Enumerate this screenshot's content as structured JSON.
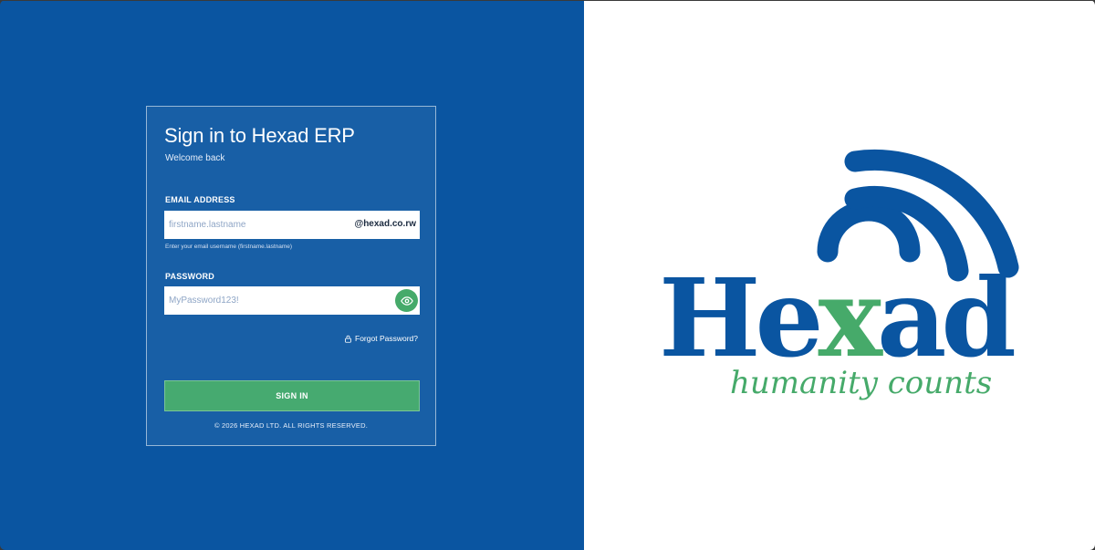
{
  "login": {
    "title": "Sign in to Hexad ERP",
    "subtitle": "Welcome back",
    "email_label": "EMAIL ADDRESS",
    "email_placeholder": "firstname.lastname",
    "email_suffix": "@hexad.co.rw",
    "email_hint": "Enter your email username (firstname.lastname)",
    "password_label": "PASSWORD",
    "password_placeholder": "MyPassword123!",
    "forgot_label": "Forgot Password?",
    "signin_label": "SIGN IN",
    "copyright": "© 2026 HEXAD LTD. ALL RIGHTS RESERVED."
  },
  "brand": {
    "name_part1": "He",
    "name_x": "x",
    "name_part2": "ad",
    "tagline": "humanity counts",
    "primary_color": "#0a55a1",
    "accent_color": "#46aa6a"
  },
  "icons": {
    "password_toggle": "eye-icon",
    "forgot": "lock-icon",
    "logo_signal": "wifi-signal-icon"
  }
}
